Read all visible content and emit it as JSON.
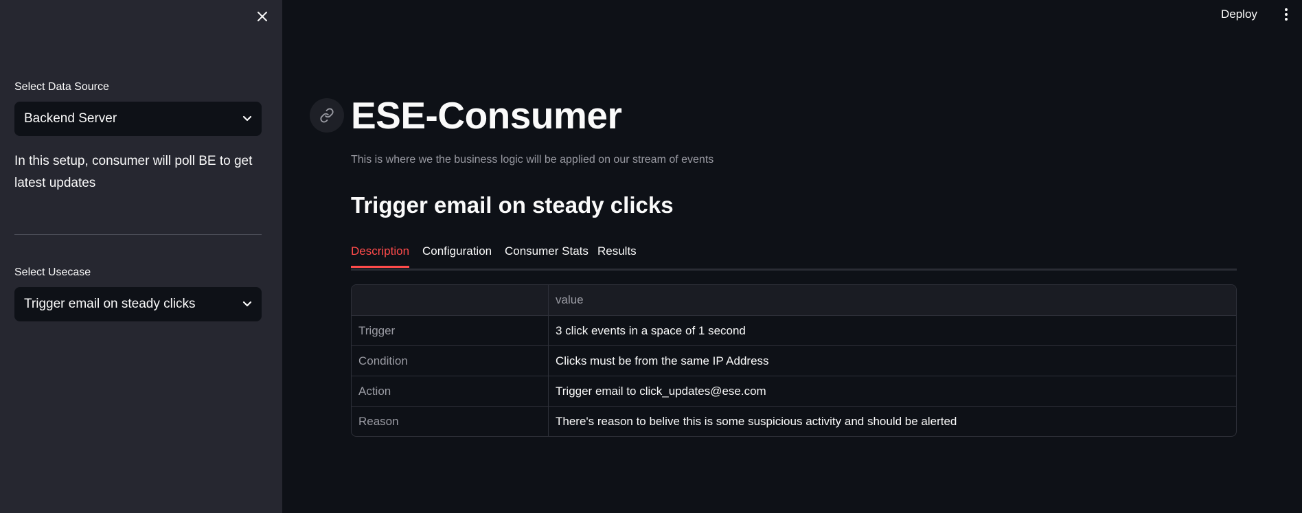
{
  "sidebar": {
    "data_source_label": "Select Data Source",
    "data_source_value": "Backend Server",
    "info_text": "In this setup, consumer will poll BE to get latest updates",
    "usecase_label": "Select Usecase",
    "usecase_value": "Trigger email on steady clicks"
  },
  "header": {
    "deploy_label": "Deploy"
  },
  "main": {
    "title": "ESE-Consumer",
    "caption": "This is where we the business logic will be applied on our stream of events",
    "section_title": "Trigger email on steady clicks",
    "tabs": [
      {
        "label": "Description",
        "active": true
      },
      {
        "label": "Configuration",
        "active": false
      },
      {
        "label": "Consumer Stats",
        "active": false
      },
      {
        "label": "Results",
        "active": false
      }
    ],
    "table": {
      "header": [
        "",
        "value"
      ],
      "rows": [
        {
          "key": "Trigger",
          "value": "3 click events in a space of 1 second"
        },
        {
          "key": "Condition",
          "value": "Clicks must be from the same IP Address"
        },
        {
          "key": "Action",
          "value": "Trigger email to click_updates@ese.com"
        },
        {
          "key": "Reason",
          "value": "There's reason to belive this is some suspicious activity and should be alerted"
        }
      ]
    }
  },
  "colors": {
    "sidebar_bg": "#262730",
    "main_bg": "#0e1117",
    "accent": "#ff4b4b"
  },
  "icons": [
    "close-icon",
    "chevron-down-icon",
    "link-icon",
    "kebab-menu-icon"
  ]
}
